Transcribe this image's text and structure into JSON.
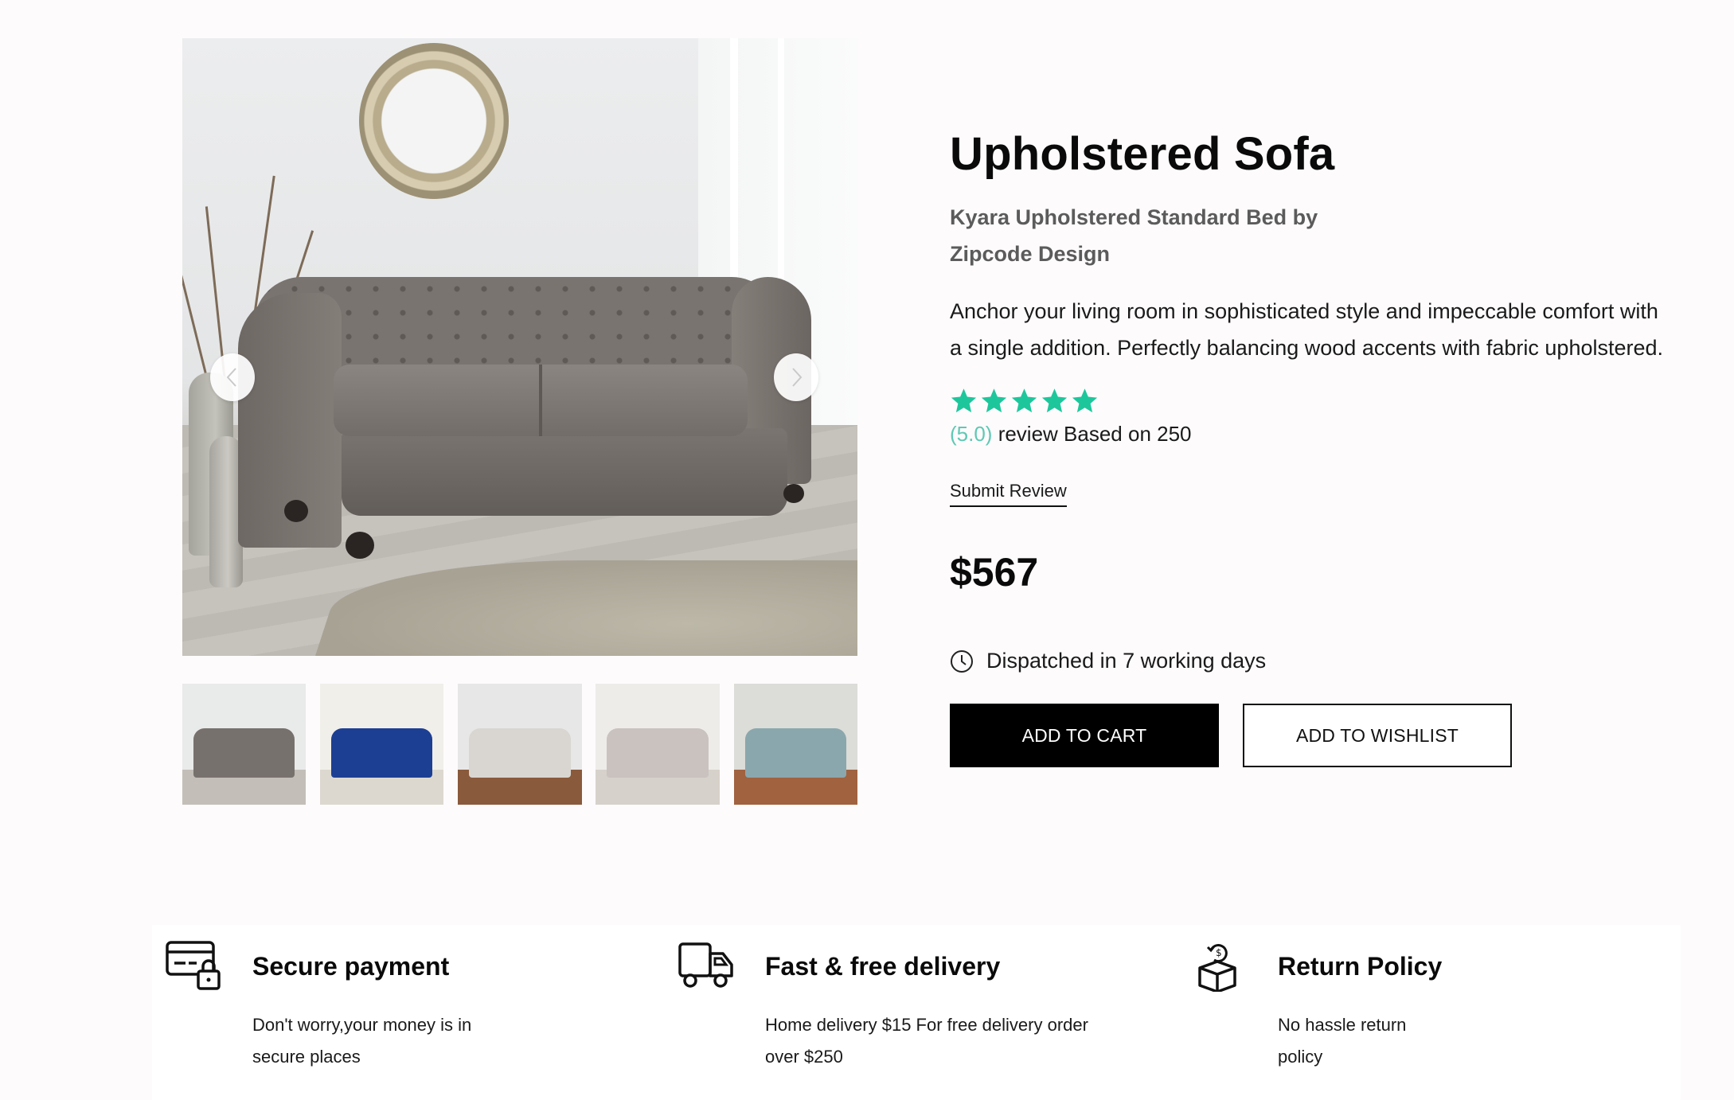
{
  "gallery": {
    "prev_icon": "chevron-left-icon",
    "next_icon": "chevron-right-icon",
    "thumbnails": [
      {
        "name": "thumbnail-grey-chesterfield",
        "sofa_color": "#77716d",
        "bg": "#e9eaea",
        "floor": "#c3beb8"
      },
      {
        "name": "thumbnail-blue-sofa",
        "sofa_color": "#1d3f93",
        "bg": "#f1efea",
        "floor": "#dcd8d0"
      },
      {
        "name": "thumbnail-white-sofa-living-room",
        "sofa_color": "#d9d6d1",
        "bg": "#e7e7e7",
        "floor": "#8a5a3c"
      },
      {
        "name": "thumbnail-beige-sofa",
        "sofa_color": "#c9c2bf",
        "bg": "#eeece9",
        "floor": "#d6d1ca"
      },
      {
        "name": "thumbnail-teal-sofa",
        "sofa_color": "#8aa7ad",
        "bg": "#dcdcd8",
        "floor": "#a0623f"
      }
    ]
  },
  "product": {
    "title": "Upholstered Sofa",
    "subtitle": "Kyara Upholstered Standard Bed by Zipcode Design",
    "description": "Anchor your living room in sophisticated style and impeccable comfort with a single addition. Perfectly balancing wood accents with fabric upholstered.",
    "rating": {
      "stars": 5,
      "star_color": "#1dc79b",
      "value_text": "(5.0)",
      "review_text": " review Based on 250"
    },
    "submit_review": "Submit Review",
    "price": "$567",
    "dispatch": "Dispatched in 7 working days",
    "add_to_cart": "ADD TO CART",
    "add_to_wishlist": "ADD TO WISHLIST"
  },
  "features": [
    {
      "icon": "credit-card-lock-icon",
      "title": "Secure payment",
      "text": "Don't worry,your money is in secure places"
    },
    {
      "icon": "delivery-truck-icon",
      "title": "Fast & free delivery",
      "text": "Home delivery $15 For free delivery order over $250"
    },
    {
      "icon": "return-box-icon",
      "title": "Return Policy",
      "text": "No hassle return policy"
    }
  ]
}
